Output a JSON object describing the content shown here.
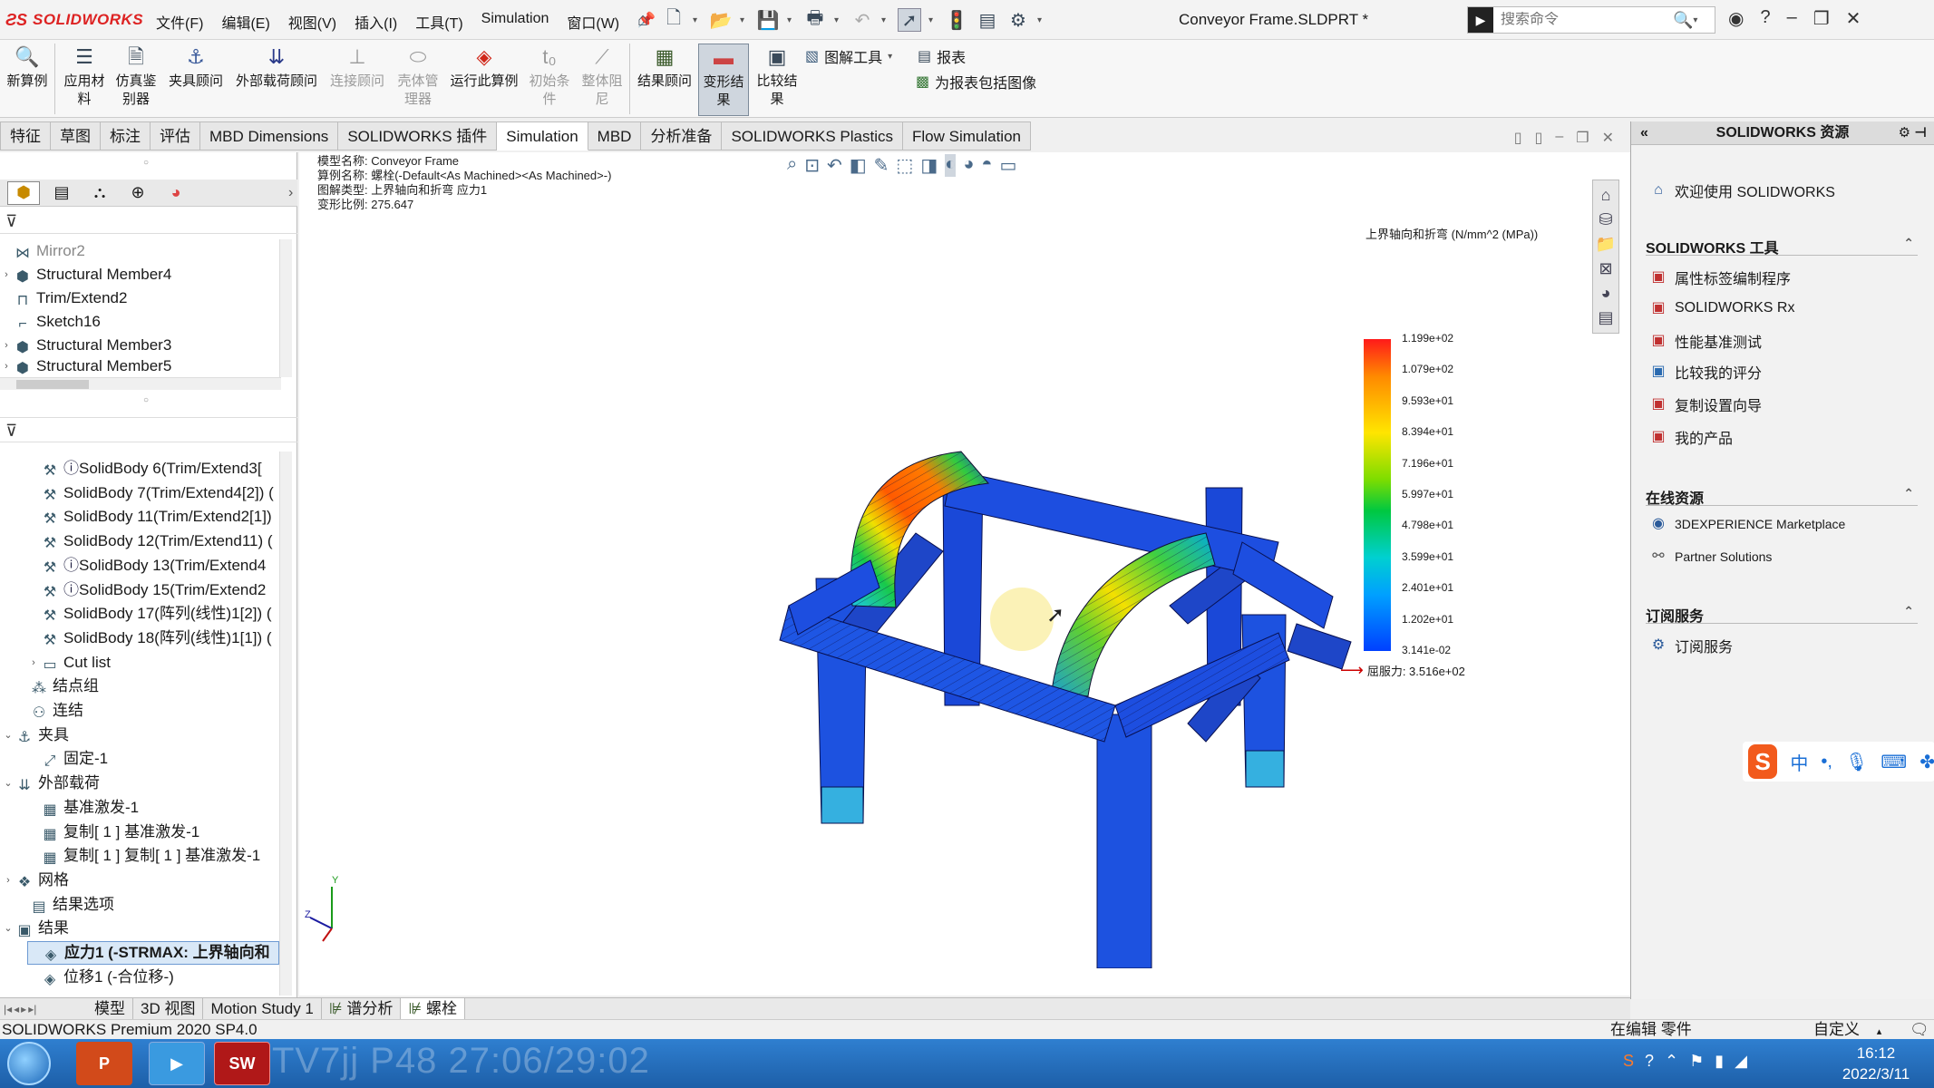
{
  "app": {
    "logo": "SOLIDWORKS",
    "menu": [
      "文件(F)",
      "编辑(E)",
      "视图(V)",
      "插入(I)",
      "工具(T)",
      "Simulation",
      "窗口(W)"
    ],
    "document_title": "Conveyor Frame.SLDPRT *",
    "search_placeholder": "搜索命令"
  },
  "ribbon": {
    "buttons": [
      {
        "label": "新算例",
        "icon": "new-study-icon"
      },
      {
        "label": "应用材料",
        "icon": "material-icon"
      },
      {
        "label": "仿真鉴别器",
        "icon": "simulation-identifier-icon"
      },
      {
        "label": "夹具顾问",
        "icon": "fixture-icon"
      },
      {
        "label": "外部载荷顾问",
        "icon": "load-icon"
      },
      {
        "label": "连接顾问",
        "icon": "connection-icon"
      },
      {
        "label": "壳体管理器",
        "icon": "shell-icon"
      },
      {
        "label": "运行此算例",
        "icon": "run-icon"
      },
      {
        "label": "初始条件",
        "icon": "initial-icon"
      },
      {
        "label": "整体阻尼",
        "icon": "damping-icon"
      },
      {
        "label": "结果顾问",
        "icon": "results-advisor-icon"
      },
      {
        "label": "变形结果",
        "icon": "deform-icon"
      },
      {
        "label": "比较结果",
        "icon": "compare-icon"
      }
    ],
    "plot_tools": "图解工具",
    "report": "报表",
    "include_image": "为报表包括图像"
  },
  "tabs": [
    "特征",
    "草图",
    "标注",
    "评估",
    "MBD Dimensions",
    "SOLIDWORKS 插件",
    "Simulation",
    "MBD",
    "分析准备",
    "SOLIDWORKS Plastics",
    "Flow Simulation"
  ],
  "selected_tab": "Simulation",
  "feature_tree": [
    {
      "label": "Mirror2",
      "state": "grey"
    },
    {
      "label": "Structural Member4"
    },
    {
      "label": "Trim/Extend2"
    },
    {
      "label": "Sketch16"
    },
    {
      "label": "Structural Member3"
    },
    {
      "label": "Structural Member5"
    }
  ],
  "sim_tree": [
    {
      "label": "SolidBody 6(Trim/Extend3["
    },
    {
      "label": "SolidBody 7(Trim/Extend4[2]) ("
    },
    {
      "label": "SolidBody 11(Trim/Extend2[1])"
    },
    {
      "label": "SolidBody 12(Trim/Extend11) ("
    },
    {
      "label": "SolidBody 13(Trim/Extend4"
    },
    {
      "label": "SolidBody 15(Trim/Extend2"
    },
    {
      "label": "SolidBody 17(阵列(线性)1[2]) ("
    },
    {
      "label": "SolidBody 18(阵列(线性)1[1]) ("
    },
    {
      "label": "Cut list"
    },
    {
      "label": "结点组"
    },
    {
      "label": "连结"
    },
    {
      "label": "夹具"
    },
    {
      "label": "固定-1"
    },
    {
      "label": "外部载荷"
    },
    {
      "label": "基准激发-1"
    },
    {
      "label": "复制[ 1 ] 基准激发-1"
    },
    {
      "label": "复制[ 1 ] 复制[ 1 ] 基准激发-1"
    },
    {
      "label": "网格"
    },
    {
      "label": "结果选项"
    },
    {
      "label": "结果"
    },
    {
      "label": "应力1 (-STRMAX: 上界轴向和"
    },
    {
      "label": "位移1 (-合位移-)"
    }
  ],
  "viewport": {
    "model_name": "模型名称: Conveyor Frame",
    "study_name": "算例名称: 螺栓(-Default<As Machined><As Machined>-)",
    "plot_type": "图解类型: 上界轴向和折弯 应力1",
    "deform_scale": "变形比例: 275.647",
    "legend_title": "上界轴向和折弯 (N/mm^2 (MPa))",
    "legend_ticks": [
      "1.199e+02",
      "1.079e+02",
      "9.593e+01",
      "8.394e+01",
      "7.196e+01",
      "5.997e+01",
      "4.798e+01",
      "3.599e+01",
      "2.401e+01",
      "1.202e+01",
      "3.141e-02"
    ],
    "yield_label": "屈服力: 3.516e+02"
  },
  "resources": {
    "title": "SOLIDWORKS 资源",
    "welcome": "欢迎使用 SOLIDWORKS",
    "tools_header": "SOLIDWORKS 工具",
    "tools": [
      "属性标签编制程序",
      "SOLIDWORKS Rx",
      "性能基准测试",
      "比较我的评分",
      "复制设置向导",
      "我的产品"
    ],
    "online_header": "在线资源",
    "online": [
      "3DEXPERIENCE Marketplace",
      "Partner Solutions"
    ],
    "subscription_header": "订阅服务",
    "subscription": [
      "订阅服务"
    ]
  },
  "bottom_tabs": [
    "模型",
    "3D 视图",
    "Motion Study 1",
    "谱分析",
    "螺栓"
  ],
  "status": {
    "version": "SOLIDWORKS Premium 2020 SP4.0",
    "editing": "在编辑 零件",
    "custom": "自定义"
  },
  "taskbar": {
    "watermark": "TV7jj P48 27:06/29:02",
    "time": "16:12",
    "date": "2022/3/11"
  },
  "colors": {
    "accent": "#d22222",
    "selected_tab_bg": "#ffffff",
    "ribbon_active": "#cfd6de"
  }
}
